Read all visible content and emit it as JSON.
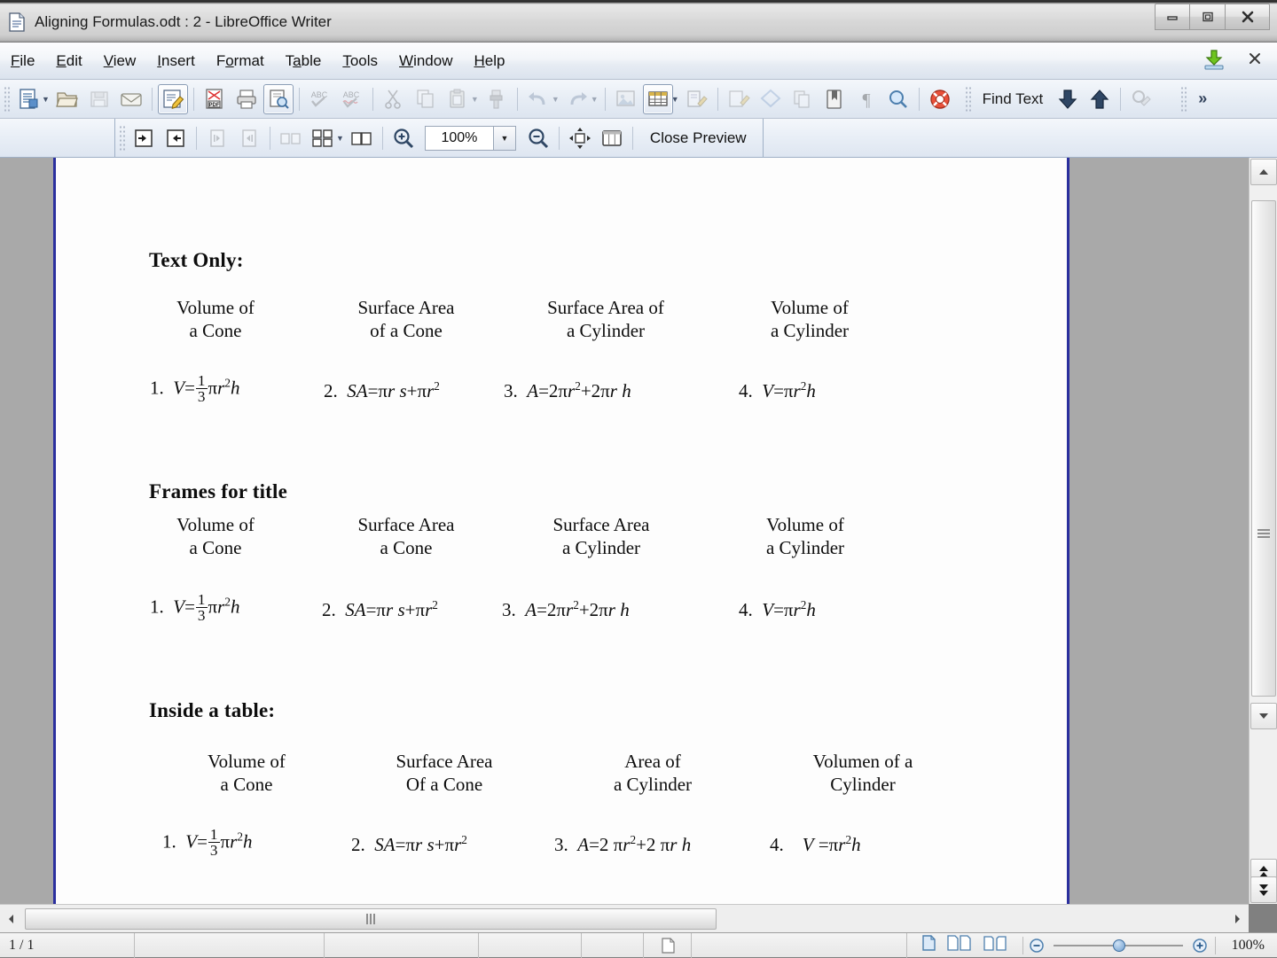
{
  "window": {
    "title": "Aligning Formulas.odt : 2 - LibreOffice Writer",
    "app_icon": "writer-document-icon",
    "controls": {
      "minimize": "minimize-icon",
      "restore": "restore-icon",
      "close": "close-icon"
    }
  },
  "menubar": {
    "items": [
      {
        "label": "File",
        "accel": "F"
      },
      {
        "label": "Edit",
        "accel": "E"
      },
      {
        "label": "View",
        "accel": "V"
      },
      {
        "label": "Insert",
        "accel": "I"
      },
      {
        "label": "Format",
        "accel": "o"
      },
      {
        "label": "Table",
        "accel": "a"
      },
      {
        "label": "Tools",
        "accel": "T"
      },
      {
        "label": "Window",
        "accel": "W"
      },
      {
        "label": "Help",
        "accel": "H"
      }
    ],
    "right_icons": [
      "download-update-icon",
      "close-document-icon"
    ]
  },
  "toolbar": {
    "find_text_label": "Find Text",
    "overflow_label": "»",
    "buttons": [
      {
        "name": "new-document-icon",
        "state": "normal",
        "dropdown": true
      },
      {
        "name": "open-file-icon",
        "state": "normal"
      },
      {
        "name": "save-icon",
        "state": "disabled"
      },
      {
        "name": "email-document-icon",
        "state": "normal"
      },
      {
        "name": "edit-mode-icon",
        "state": "active"
      },
      {
        "name": "export-pdf-icon",
        "state": "normal"
      },
      {
        "name": "print-icon",
        "state": "normal"
      },
      {
        "name": "print-preview-icon",
        "state": "active"
      },
      {
        "name": "spelling-check-icon",
        "state": "disabled"
      },
      {
        "name": "autospellcheck-icon",
        "state": "disabled"
      },
      {
        "name": "cut-icon",
        "state": "disabled"
      },
      {
        "name": "copy-icon",
        "state": "disabled"
      },
      {
        "name": "paste-icon",
        "state": "disabled",
        "dropdown": true
      },
      {
        "name": "clone-formatting-icon",
        "state": "disabled"
      },
      {
        "name": "undo-icon",
        "state": "disabled",
        "dropdown": true
      },
      {
        "name": "redo-icon",
        "state": "disabled",
        "dropdown": true
      },
      {
        "name": "insert-image-icon",
        "state": "disabled"
      },
      {
        "name": "insert-table-icon",
        "state": "normal",
        "dropdown": true
      },
      {
        "name": "insert-text-box-icon",
        "state": "disabled"
      },
      {
        "name": "insert-field-icon",
        "state": "disabled"
      },
      {
        "name": "insert-special-character-icon",
        "state": "disabled"
      },
      {
        "name": "insert-section-icon",
        "state": "disabled"
      },
      {
        "name": "insert-bookmark-icon",
        "state": "disabled"
      },
      {
        "name": "formatting-marks-icon",
        "state": "disabled"
      },
      {
        "name": "zoom-icon",
        "state": "normal"
      },
      {
        "name": "help-icon",
        "state": "normal"
      },
      {
        "name": "find-next-down-icon",
        "state": "normal"
      },
      {
        "name": "find-previous-up-icon",
        "state": "normal"
      },
      {
        "name": "find-replace-icon",
        "state": "disabled"
      }
    ]
  },
  "preview_toolbar": {
    "zoom_value": "100%",
    "close_label": "Close Preview",
    "buttons": [
      {
        "name": "previous-page-icon",
        "state": "normal"
      },
      {
        "name": "next-page-icon",
        "state": "normal"
      },
      {
        "name": "first-page-icon",
        "state": "disabled"
      },
      {
        "name": "last-page-icon",
        "state": "disabled"
      },
      {
        "name": "two-page-preview-icon",
        "state": "disabled"
      },
      {
        "name": "multiple-page-preview-icon",
        "state": "normal",
        "dropdown": true
      },
      {
        "name": "book-preview-icon",
        "state": "normal"
      },
      {
        "name": "zoom-in-icon",
        "state": "normal"
      },
      {
        "name": "zoom-out-icon",
        "state": "normal"
      },
      {
        "name": "full-screen-icon",
        "state": "normal"
      },
      {
        "name": "print-page-view-icon",
        "state": "normal"
      }
    ]
  },
  "document": {
    "sections": [
      {
        "title": "Text Only:",
        "headers": [
          "Volume of\na Cone",
          "Surface Area\nof a Cone",
          "Surface Area of\na Cylinder",
          "Volume of\na  Cylinder"
        ],
        "numbers": [
          "1.",
          "2.",
          "3.",
          "4."
        ],
        "formulas": [
          "V = (1/3) π r² h",
          "SA = π r s + π r²",
          "A = 2π r² + 2 π r h",
          "V = π r² h"
        ]
      },
      {
        "title": "Frames for title",
        "headers": [
          "Volume of\na Cone",
          "Surface Area\na Cone",
          "Surface Area\na  Cylinder",
          "Volume of\na  Cylinder"
        ],
        "numbers": [
          "1.",
          "2.",
          "3.",
          "4."
        ],
        "formulas": [
          "V = (1/3) π r² h",
          "SA = π r s + π r²",
          "A = 2π r² + 2 π r h",
          "V = π r² h"
        ]
      },
      {
        "title": "Inside a table:",
        "headers": [
          "Volume of\na Cone",
          "Surface Area\nOf a Cone",
          "Area of\na Cylinder",
          "Volumen of a\nCylinder"
        ],
        "numbers": [
          "1.",
          "2.",
          "3.",
          "4."
        ],
        "formulas": [
          "V = (1/3) π r² h",
          "SA = π r s + π r²",
          "A = 2 π r² + 2 π r h",
          "V = π r² h"
        ]
      }
    ],
    "text": {
      "s1_t": "Text Only:",
      "s1_h1a": "Volume of",
      "s1_h1b": "a Cone",
      "s1_h2a": "Surface Area",
      "s1_h2b": "of a Cone",
      "s1_h3a": "Surface Area of",
      "s1_h3b": "a Cylinder",
      "s1_h4a": "Volume of",
      "s1_h4b": "a  Cylinder",
      "s2_t": "Frames for title",
      "s2_h1a": "Volume of",
      "s2_h1b": "a Cone",
      "s2_h2a": "Surface Area",
      "s2_h2b": "a Cone",
      "s2_h3a": "Surface Area",
      "s2_h3b": "a  Cylinder",
      "s2_h4a": "Volume of",
      "s2_h4b": "a  Cylinder",
      "s3_t": "Inside a table:",
      "s3_h1a": "Volume of",
      "s3_h1b": "a Cone",
      "s3_h2a": "Surface Area",
      "s3_h2b": "Of a Cone",
      "s3_h3a": "Area of",
      "s3_h3b": "a Cylinder",
      "s3_h4a": "Volumen of a",
      "s3_h4b": "Cylinder",
      "n1": "1.",
      "n2": "2.",
      "n3": "3.",
      "n4": "4.",
      "fr_num": "1",
      "fr_den": "3"
    }
  },
  "statusbar": {
    "page_count": "1 / 1",
    "word_count": "",
    "style": "",
    "language": "",
    "insert_mode": "",
    "selection_mode": "",
    "zoom_percent": "100%",
    "view_icons": [
      "single-page-view-icon",
      "multi-page-view-icon",
      "book-view-icon"
    ]
  },
  "colors": {
    "page_border": "#2b2f9e",
    "workspace": "#a9a9a9",
    "toolbar_bg": "#e7edf5",
    "accent": "#3f6fa0"
  }
}
